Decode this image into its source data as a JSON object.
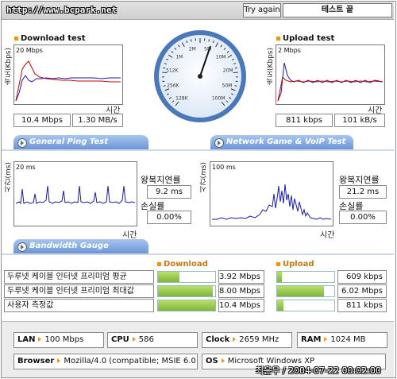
{
  "header": {
    "url": "http://www.bcpark.net",
    "try_again": "Try again",
    "end_test": "테스트 끝"
  },
  "download": {
    "title": "Download test",
    "yaxis_label": "속도(Kbps)",
    "ytick": "20 Mbps",
    "xaxis_label": "시간",
    "speed_mbps": "10.4 Mbps",
    "speed_mbs": "1.30 MB/s"
  },
  "upload": {
    "title": "Upload test",
    "yaxis_label": "속도(Kbps)",
    "ytick": "2 Mbps",
    "xaxis_label": "시간",
    "speed_kbps": "811 kbps",
    "speed_kbs": "101 kB/s"
  },
  "gauge": {
    "labels": [
      "128K",
      "256K",
      "512K",
      "1M",
      "2M",
      "5M",
      "10M",
      "20M",
      "50M",
      "100M"
    ]
  },
  "tabs": {
    "ping": "General Ping Test",
    "game": "Network Game & VoIP Test",
    "bandwidth": "Bandwidth Gauge"
  },
  "ping": {
    "yaxis_label": "시간(ms)",
    "ytick": "20 ms",
    "xaxis_label": "시간",
    "rtt_label": "왕복지연률",
    "rtt_value": "9.2 ms",
    "loss_label": "손실률",
    "loss_value": "0.00%"
  },
  "game": {
    "yaxis_label": "시간(ms)",
    "ytick": "100 ms",
    "xaxis_label": "시간",
    "rtt_label": "왕복지연률",
    "rtt_value": "21.2 ms",
    "loss_label": "손실률",
    "loss_value": "0.00%"
  },
  "bandwidth": {
    "download_header": "Download",
    "upload_header": "Upload",
    "rows": [
      {
        "label": "두루넷 케이블 인터넷 프리미엄 평균",
        "down": "3.92 Mbps",
        "down_frac": 0.38,
        "up": "609 kbps",
        "up_frac": 0.08
      },
      {
        "label": "두루넷 케이블 인터넷 프리미엄 최대값",
        "down": "8.00 Mbps",
        "down_frac": 0.96,
        "up": "6.02 Mbps",
        "up_frac": 0.82
      },
      {
        "label": "사용자 측정값",
        "down": "10.4 Mbps",
        "down_frac": 1.0,
        "up": "811 kbps",
        "up_frac": 0.11
      }
    ]
  },
  "system": {
    "lan_label": "LAN",
    "lan_value": "100 Mbps",
    "cpu_label": "CPU",
    "cpu_value": "586",
    "clock_label": "Clock",
    "clock_value": "2659 MHz",
    "ram_label": "RAM",
    "ram_value": "1024 MB",
    "browser_label": "Browser",
    "browser_value": "Mozilla/4.0 (compatible; MSIE 6.0",
    "os_label": "OS",
    "os_value": "Microsoft Windows XP",
    "signature": "최윤우 / 2004-07-22 00:02:00"
  },
  "colors": {
    "accent_orange": "#f3921b",
    "tab_blue": "#6c95d6",
    "bar_green": "#7fb53a",
    "series_red": "#cc0000",
    "series_blue": "#1a1aa8"
  }
}
